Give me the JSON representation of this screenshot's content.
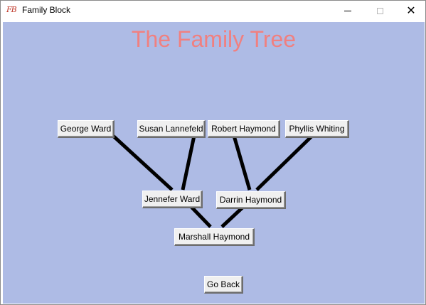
{
  "window": {
    "title": "Family Block",
    "icon": "FB",
    "controls": {
      "minimize_icon": "minimize-icon",
      "maximize_icon": "maximize-icon",
      "close_icon": "close-icon",
      "close_glyph": "✕"
    }
  },
  "page": {
    "title": "The Family Tree",
    "title_color": "#f08080",
    "background_color": "#aebbe5"
  },
  "people": {
    "george_ward": "George Ward",
    "susan_lannefeld": "Susan Lannefeld",
    "robert_haymond": "Robert Haymond",
    "phyllis_whiting": "Phyllis Whiting",
    "jennefer_ward": "Jennefer Ward",
    "darrin_haymond": "Darrin Haymond",
    "marshall_haymond": "Marshall Haymond"
  },
  "go_back_label": "Go Back"
}
